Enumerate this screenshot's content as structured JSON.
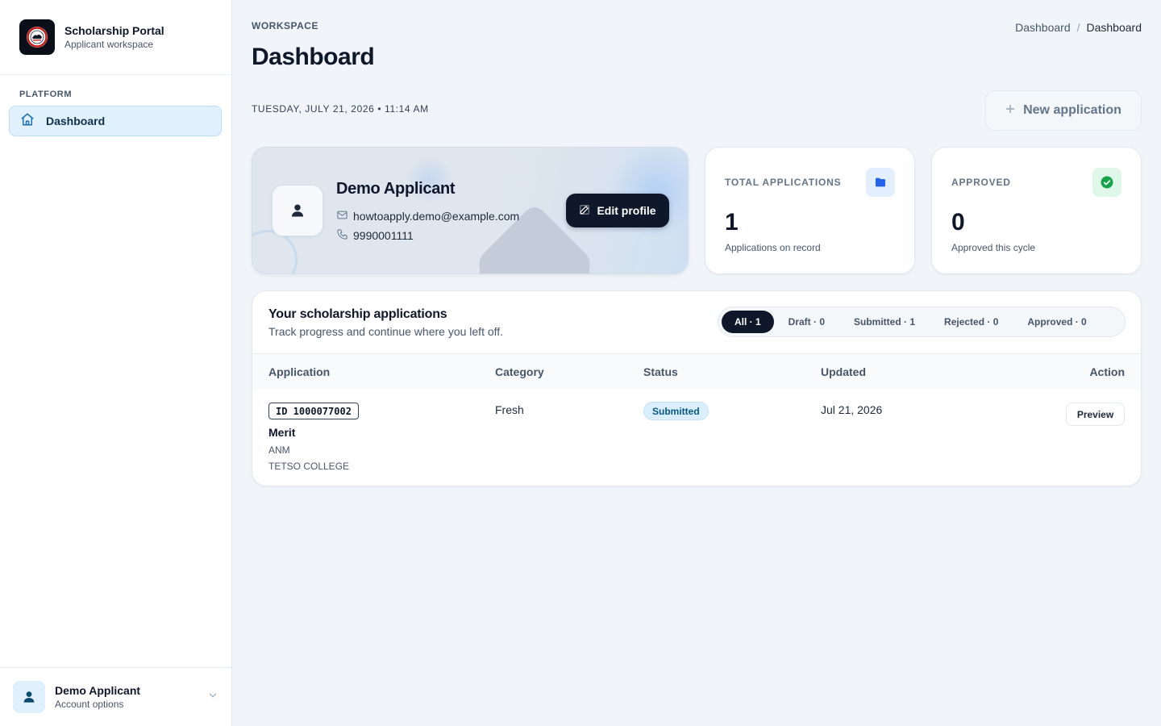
{
  "brand": {
    "title": "Scholarship Portal",
    "subtitle": "Applicant workspace",
    "logo_icon": "emblem-logo-icon"
  },
  "sidebar": {
    "section_label": "PLATFORM",
    "items": [
      {
        "label": "Dashboard",
        "icon": "home-icon",
        "active": true
      }
    ]
  },
  "account": {
    "name": "Demo Applicant",
    "subtitle": "Account options"
  },
  "header": {
    "eyebrow": "WORKSPACE",
    "title": "Dashboard",
    "breadcrumb": [
      "Dashboard",
      "Dashboard"
    ],
    "breadcrumb_sep": "/",
    "datetime": "TUESDAY, JULY 21, 2026 • 11:14 AM",
    "new_application_label": "New application",
    "new_application_plus": "+"
  },
  "profile": {
    "name": "Demo Applicant",
    "email": "howtoapply.demo@example.com",
    "phone": "9990001111",
    "edit_label": "Edit profile"
  },
  "stats": {
    "total": {
      "label": "TOTAL APPLICATIONS",
      "value": "1",
      "sub": "Applications on record",
      "icon": "folder-icon",
      "color": "#2563eb"
    },
    "approved": {
      "label": "APPROVED",
      "value": "0",
      "sub": "Approved this cycle",
      "icon": "check-circle-icon",
      "color": "#16a34a"
    }
  },
  "applications": {
    "title": "Your scholarship applications",
    "subtitle": "Track progress and continue where you left off.",
    "filters": [
      {
        "label": "All · 1",
        "active": true
      },
      {
        "label": "Draft · 0",
        "active": false
      },
      {
        "label": "Submitted · 1",
        "active": false
      },
      {
        "label": "Rejected · 0",
        "active": false
      },
      {
        "label": "Approved · 0",
        "active": false
      }
    ],
    "columns": [
      "Application",
      "Category",
      "Status",
      "Updated",
      "Action"
    ],
    "rows": [
      {
        "id": "ID 1000077002",
        "scheme": "Merit",
        "course": "ANM",
        "college": "TETSO COLLEGE",
        "category": "Fresh",
        "status": "Submitted",
        "updated": "Jul 21, 2026",
        "action": "Preview"
      }
    ]
  }
}
